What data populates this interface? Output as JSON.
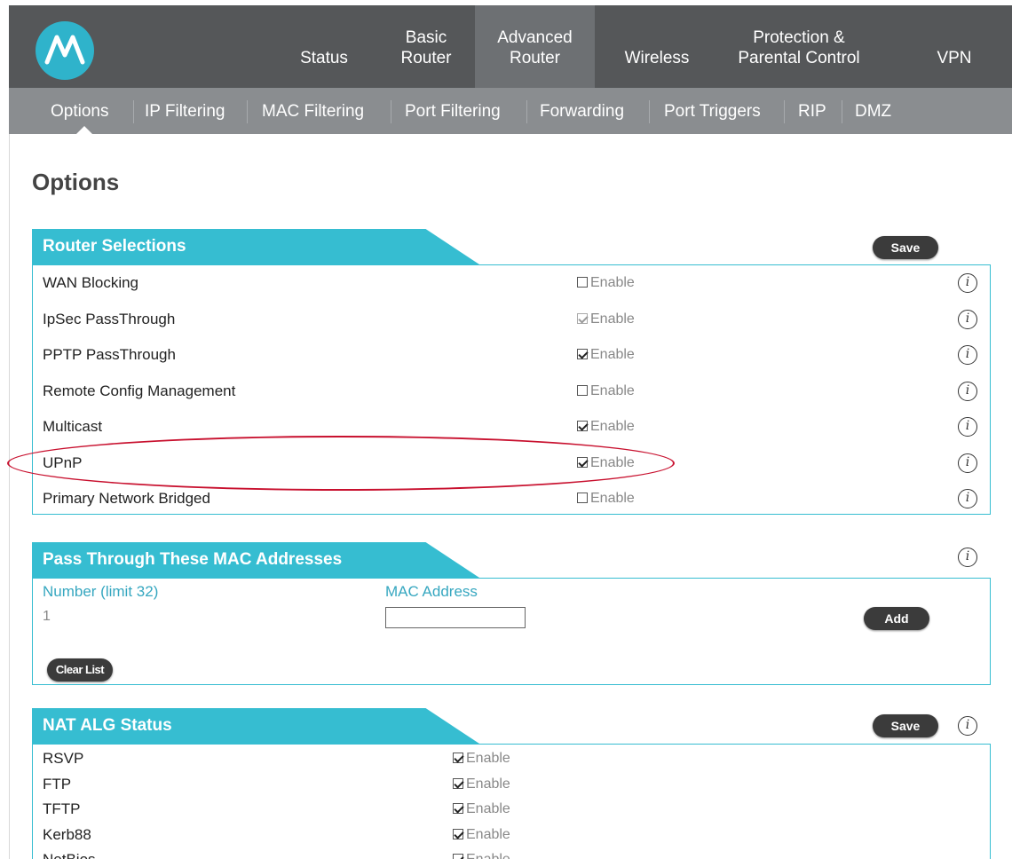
{
  "top_nav": {
    "items": [
      {
        "label": "Status"
      },
      {
        "label": "Basic\nRouter"
      },
      {
        "label": "Advanced\nRouter"
      },
      {
        "label": "Wireless"
      },
      {
        "label": "Protection &\nParental Control"
      },
      {
        "label": "VPN"
      }
    ],
    "active_index": 2
  },
  "sub_nav": {
    "items": [
      "Options",
      "IP Filtering",
      "MAC Filtering",
      "Port Filtering",
      "Forwarding",
      "Port Triggers",
      "RIP",
      "DMZ"
    ],
    "active": "Options"
  },
  "page_title": "Options",
  "router_selections": {
    "title": "Router Selections",
    "save_label": "Save",
    "enable_label": "Enable",
    "rows": [
      {
        "label": "WAN Blocking",
        "checked": false,
        "disabled": false
      },
      {
        "label": "IpSec PassThrough",
        "checked": true,
        "disabled": true
      },
      {
        "label": "PPTP PassThrough",
        "checked": true,
        "disabled": false
      },
      {
        "label": "Remote Config Management",
        "checked": false,
        "disabled": false
      },
      {
        "label": "Multicast",
        "checked": true,
        "disabled": false
      },
      {
        "label": "UPnP",
        "checked": true,
        "disabled": false
      },
      {
        "label": "Primary Network Bridged",
        "checked": false,
        "disabled": false
      }
    ]
  },
  "pass_through": {
    "title": "Pass Through These MAC Addresses",
    "number_header": "Number (limit 32)",
    "mac_header": "MAC Address",
    "row_number": "1",
    "mac_value": "",
    "add_label": "Add",
    "clear_label": "Clear List"
  },
  "nat_alg": {
    "title": "NAT ALG Status",
    "save_label": "Save",
    "enable_label": "Enable",
    "rows": [
      {
        "label": "RSVP",
        "checked": true
      },
      {
        "label": "FTP",
        "checked": true
      },
      {
        "label": "TFTP",
        "checked": true
      },
      {
        "label": "Kerb88",
        "checked": true
      },
      {
        "label": "NetBios",
        "checked": true
      }
    ]
  },
  "colors": {
    "accent": "#36bdd1",
    "topbar": "#555759",
    "subbar": "#8a8d90",
    "highlight": "#c8102e"
  }
}
